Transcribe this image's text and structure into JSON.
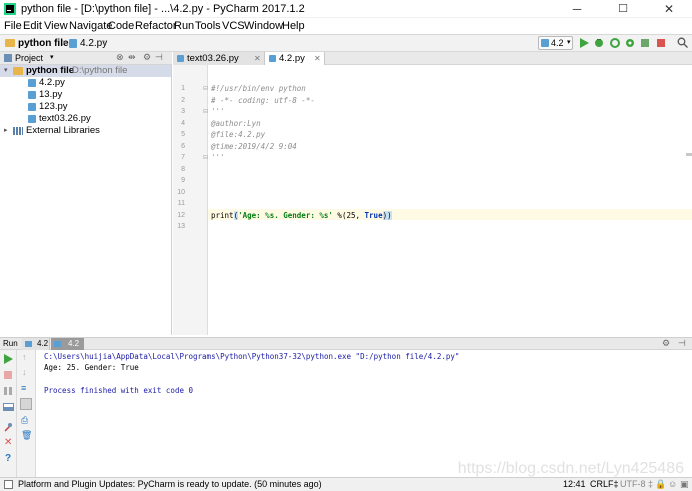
{
  "window": {
    "title": "python file - [D:\\python file] - ...\\4.2.py - PyCharm 2017.1.2",
    "minimize": "─",
    "maximize": "☐",
    "close": "✕"
  },
  "menu": [
    "File",
    "Edit",
    "View",
    "Navigate",
    "Code",
    "Refactor",
    "Run",
    "Tools",
    "VCS",
    "Window",
    "Help"
  ],
  "navbar": {
    "project": "python file",
    "file": "4.2.py",
    "run_config": "4.2"
  },
  "project_panel": {
    "label": "Project",
    "root": "python file",
    "root_path": "D:\\python file",
    "files": [
      "4.2.py",
      "13.py",
      "123.py",
      "text03.26.py"
    ],
    "external": "External Libraries"
  },
  "editor": {
    "tabs": [
      "text03.26.py",
      "4.2.py"
    ],
    "line_numbers": [
      "1",
      "2",
      "3",
      "4",
      "5",
      "6",
      "7",
      "8",
      "9",
      "10",
      "11",
      "12",
      "13"
    ],
    "lines": [
      "#!/usr/bin/env python",
      "# -*- coding: utf-8 -*-",
      "'''",
      "@author:Lyn",
      "@file:4.2.py",
      "@time:2019/4/2 9:04",
      "'''",
      "",
      "",
      "",
      "",
      "",
      ""
    ],
    "print_call": {
      "func": "print",
      "open": "(",
      "string": "'Age: %s. Gender: %s'",
      "rest": " %(25, ",
      "kw": "True",
      "close": "))"
    }
  },
  "run_panel": {
    "label": "Run",
    "tabs": [
      "4.2",
      "4.2"
    ],
    "output": [
      "C:\\Users\\huijia\\AppData\\Local\\Programs\\Python\\Python37-32\\python.exe \"D:/python file/4.2.py\"",
      "Age: 25. Gender: True",
      "",
      "Process finished with exit code 0"
    ]
  },
  "status": {
    "message": "Platform and Plugin Updates: PyCharm is ready to update. (50 minutes ago)",
    "position": "12:41",
    "line_sep": "CRLF‡",
    "encoding": "UTF-8 ‡"
  },
  "watermark": "https://blog.csdn.net/Lyn425486",
  "colors": {
    "accent": "#2675bf",
    "run_green": "#3fa33f",
    "stop_red": "#d9534f",
    "highlight_line": "#fffae3"
  }
}
